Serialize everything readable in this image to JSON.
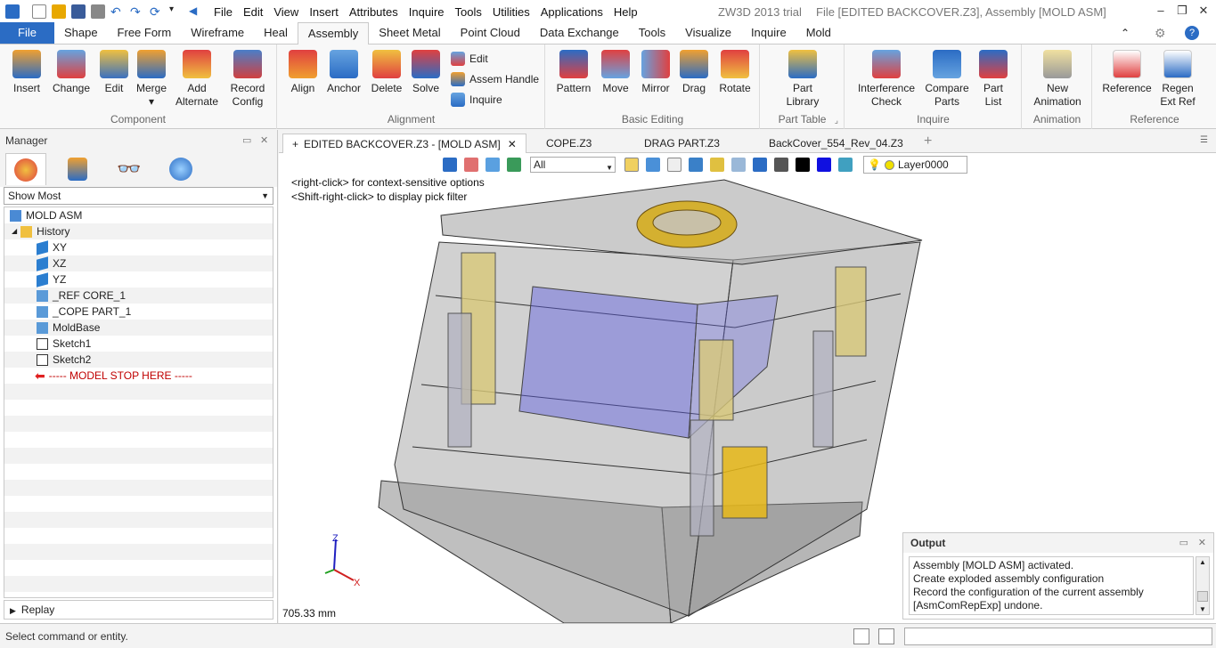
{
  "window": {
    "app_title": "ZW3D 2013 trial",
    "file_title": "File [EDITED BACKCOVER.Z3],  Assembly [MOLD ASM]",
    "menu": [
      "File",
      "Edit",
      "View",
      "Insert",
      "Attributes",
      "Inquire",
      "Tools",
      "Utilities",
      "Applications",
      "Help"
    ]
  },
  "ribbon_tabs": [
    "File",
    "Shape",
    "Free Form",
    "Wireframe",
    "Heal",
    "Assembly",
    "Sheet Metal",
    "Point Cloud",
    "Data Exchange",
    "Tools",
    "Visualize",
    "Inquire",
    "Mold"
  ],
  "ribbon": {
    "component": {
      "label": "Component",
      "buttons": [
        "Insert",
        "Change",
        "Edit",
        "Merge",
        "Add\nAlternate",
        "Record\nConfig"
      ]
    },
    "alignment": {
      "label": "Alignment",
      "buttons": [
        "Align",
        "Anchor",
        "Delete",
        "Solve"
      ],
      "small": [
        "Edit",
        "Assem Handle",
        "Inquire"
      ]
    },
    "basic_editing": {
      "label": "Basic Editing",
      "buttons": [
        "Pattern",
        "Move",
        "Mirror",
        "Drag",
        "Rotate"
      ]
    },
    "part_table": {
      "label": "Part Table",
      "buttons": [
        "Part\nLibrary"
      ]
    },
    "inquire": {
      "label": "Inquire",
      "buttons": [
        "Interference\nCheck",
        "Compare\nParts",
        "Part\nList"
      ]
    },
    "animation": {
      "label": "Animation",
      "buttons": [
        "New\nAnimation"
      ]
    },
    "reference": {
      "label": "Reference",
      "buttons": [
        "Reference",
        "Regen\nExt Ref"
      ]
    }
  },
  "manager": {
    "title": "Manager",
    "filter": "Show Most",
    "tree": [
      {
        "label": "MOLD ASM",
        "icon": "assembly-icon"
      },
      {
        "label": "History",
        "icon": "folder-icon"
      },
      {
        "label": "XY",
        "icon": "plane-icon"
      },
      {
        "label": "XZ",
        "icon": "plane-icon"
      },
      {
        "label": "YZ",
        "icon": "plane-icon"
      },
      {
        "label": "_REF CORE_1",
        "icon": "component-icon"
      },
      {
        "label": "_COPE PART_1",
        "icon": "component-icon"
      },
      {
        "label": "MoldBase",
        "icon": "component-icon"
      },
      {
        "label": "Sketch1",
        "icon": "sketch-icon"
      },
      {
        "label": "Sketch2",
        "icon": "sketch-icon"
      },
      {
        "label": "----- MODEL STOP HERE -----",
        "icon": "stop-arrow-icon"
      }
    ],
    "replay": "Replay"
  },
  "doc_tabs": [
    "EDITED BACKCOVER.Z3 - [MOLD ASM]",
    "COPE.Z3",
    "DRAG PART.Z3",
    "BackCover_554_Rev_04.Z3"
  ],
  "viewport": {
    "filter": "All",
    "layer": "Layer0000",
    "hint1": "<right-click> for context-sensitive options",
    "hint2": "<Shift-right-click> to display pick filter",
    "measure": "705.33 mm",
    "axis_x": "X",
    "axis_z": "Z"
  },
  "output": {
    "title": "Output",
    "lines": [
      "Assembly [MOLD ASM] activated.",
      "Create exploded assembly configuration",
      "Record the configuration of the current assembly",
      "[AsmComRepExp] undone."
    ]
  },
  "status": {
    "text": "Select command or entity."
  },
  "colors": {
    "file_tab": "#2b6cc4",
    "stop_marker": "#c00000"
  }
}
